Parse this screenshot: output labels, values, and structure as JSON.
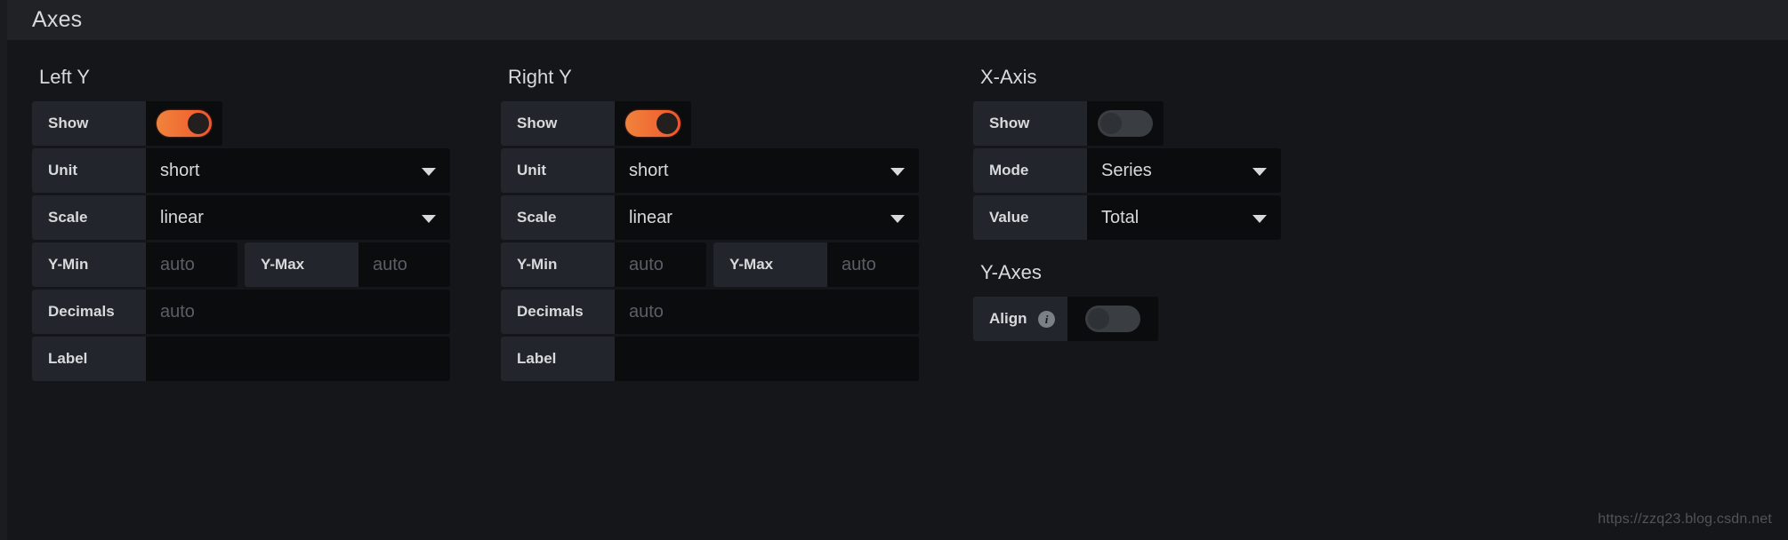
{
  "header": {
    "title": "Axes"
  },
  "left_y": {
    "section_title": "Left Y",
    "show": {
      "label": "Show",
      "state": "on"
    },
    "unit": {
      "label": "Unit",
      "value": "short"
    },
    "scale": {
      "label": "Scale",
      "value": "linear"
    },
    "y_min": {
      "label": "Y-Min",
      "value": "",
      "placeholder": "auto"
    },
    "y_max": {
      "label": "Y-Max",
      "value": "",
      "placeholder": "auto"
    },
    "decimals": {
      "label": "Decimals",
      "value": "",
      "placeholder": "auto"
    },
    "axis_label": {
      "label": "Label",
      "value": "",
      "placeholder": ""
    }
  },
  "right_y": {
    "section_title": "Right Y",
    "show": {
      "label": "Show",
      "state": "on"
    },
    "unit": {
      "label": "Unit",
      "value": "short"
    },
    "scale": {
      "label": "Scale",
      "value": "linear"
    },
    "y_min": {
      "label": "Y-Min",
      "value": "",
      "placeholder": "auto"
    },
    "y_max": {
      "label": "Y-Max",
      "value": "",
      "placeholder": "auto"
    },
    "decimals": {
      "label": "Decimals",
      "value": "",
      "placeholder": "auto"
    },
    "axis_label": {
      "label": "Label",
      "value": "",
      "placeholder": ""
    }
  },
  "x_axis": {
    "section_title": "X-Axis",
    "show": {
      "label": "Show",
      "state": "off"
    },
    "mode": {
      "label": "Mode",
      "value": "Series"
    },
    "value": {
      "label": "Value",
      "value": "Total"
    }
  },
  "y_axes": {
    "section_title": "Y-Axes",
    "align": {
      "label": "Align",
      "state": "off",
      "info_glyph": "i"
    }
  },
  "watermark": "https://zzq23.blog.csdn.net",
  "colors": {
    "page_bg": "#141619",
    "header_bg": "#202226",
    "label_bg": "#22252b",
    "field_bg": "#0b0c0e",
    "text": "#d8d9da",
    "placeholder": "#5a5f66",
    "toggle_on_start": "#ef843c",
    "toggle_on_end": "#f2552c",
    "toggle_off": "#3a3d42"
  }
}
